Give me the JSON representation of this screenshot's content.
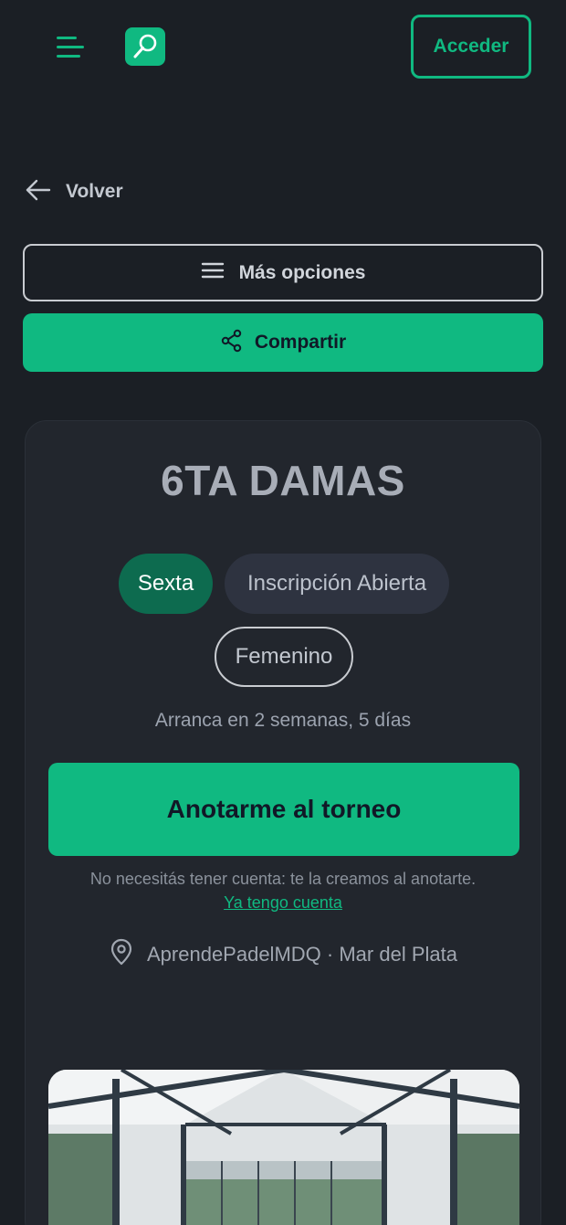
{
  "header": {
    "menu_icon": "hamburger-menu-icon",
    "logo_icon": "padel-racket-icon",
    "login_label": "Acceder"
  },
  "nav": {
    "back_label": "Volver",
    "back_icon": "arrow-left-icon"
  },
  "actions": {
    "more_options_label": "Más opciones",
    "share_label": "Compartir"
  },
  "tournament": {
    "title": "6TA DAMAS",
    "level": "Sexta",
    "status": "Inscripción Abierta",
    "gender": "Femenino",
    "starts_in": "Arranca en 2 semanas, 5 días",
    "join_label": "Anotarme al torneo",
    "no_account_note": "No necesitás tener cuenta: te la creamos al anotarte.",
    "have_account_link": "Ya tengo cuenta",
    "club": "AprendePadelMDQ",
    "city": "Mar del Plata",
    "separator": "·"
  },
  "colors": {
    "accent": "#10b981",
    "background": "#1b1f25",
    "card": "#22262d",
    "pill_level": "#0d6b4f",
    "pill_status": "#2e3340"
  }
}
